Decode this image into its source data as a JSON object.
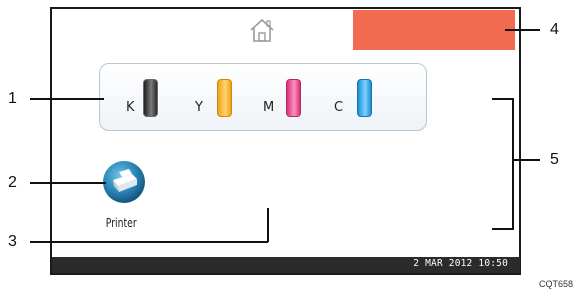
{
  "screen": {
    "home_icon": "home-icon",
    "message_area_color": "#f26a4f",
    "toner": [
      {
        "label": "K",
        "color": "#3d3d3d"
      },
      {
        "label": "Y",
        "color": "#f6b530"
      },
      {
        "label": "M",
        "color": "#e8418d"
      },
      {
        "label": "C",
        "color": "#2a9fe0"
      }
    ],
    "printer": {
      "icon": "printer-icon",
      "label": "Printer"
    },
    "status_bar": {
      "datetime": "2 MAR  2012 10:50"
    }
  },
  "callouts": [
    "1",
    "2",
    "3",
    "4",
    "5"
  ],
  "figure_id": "CQT658"
}
